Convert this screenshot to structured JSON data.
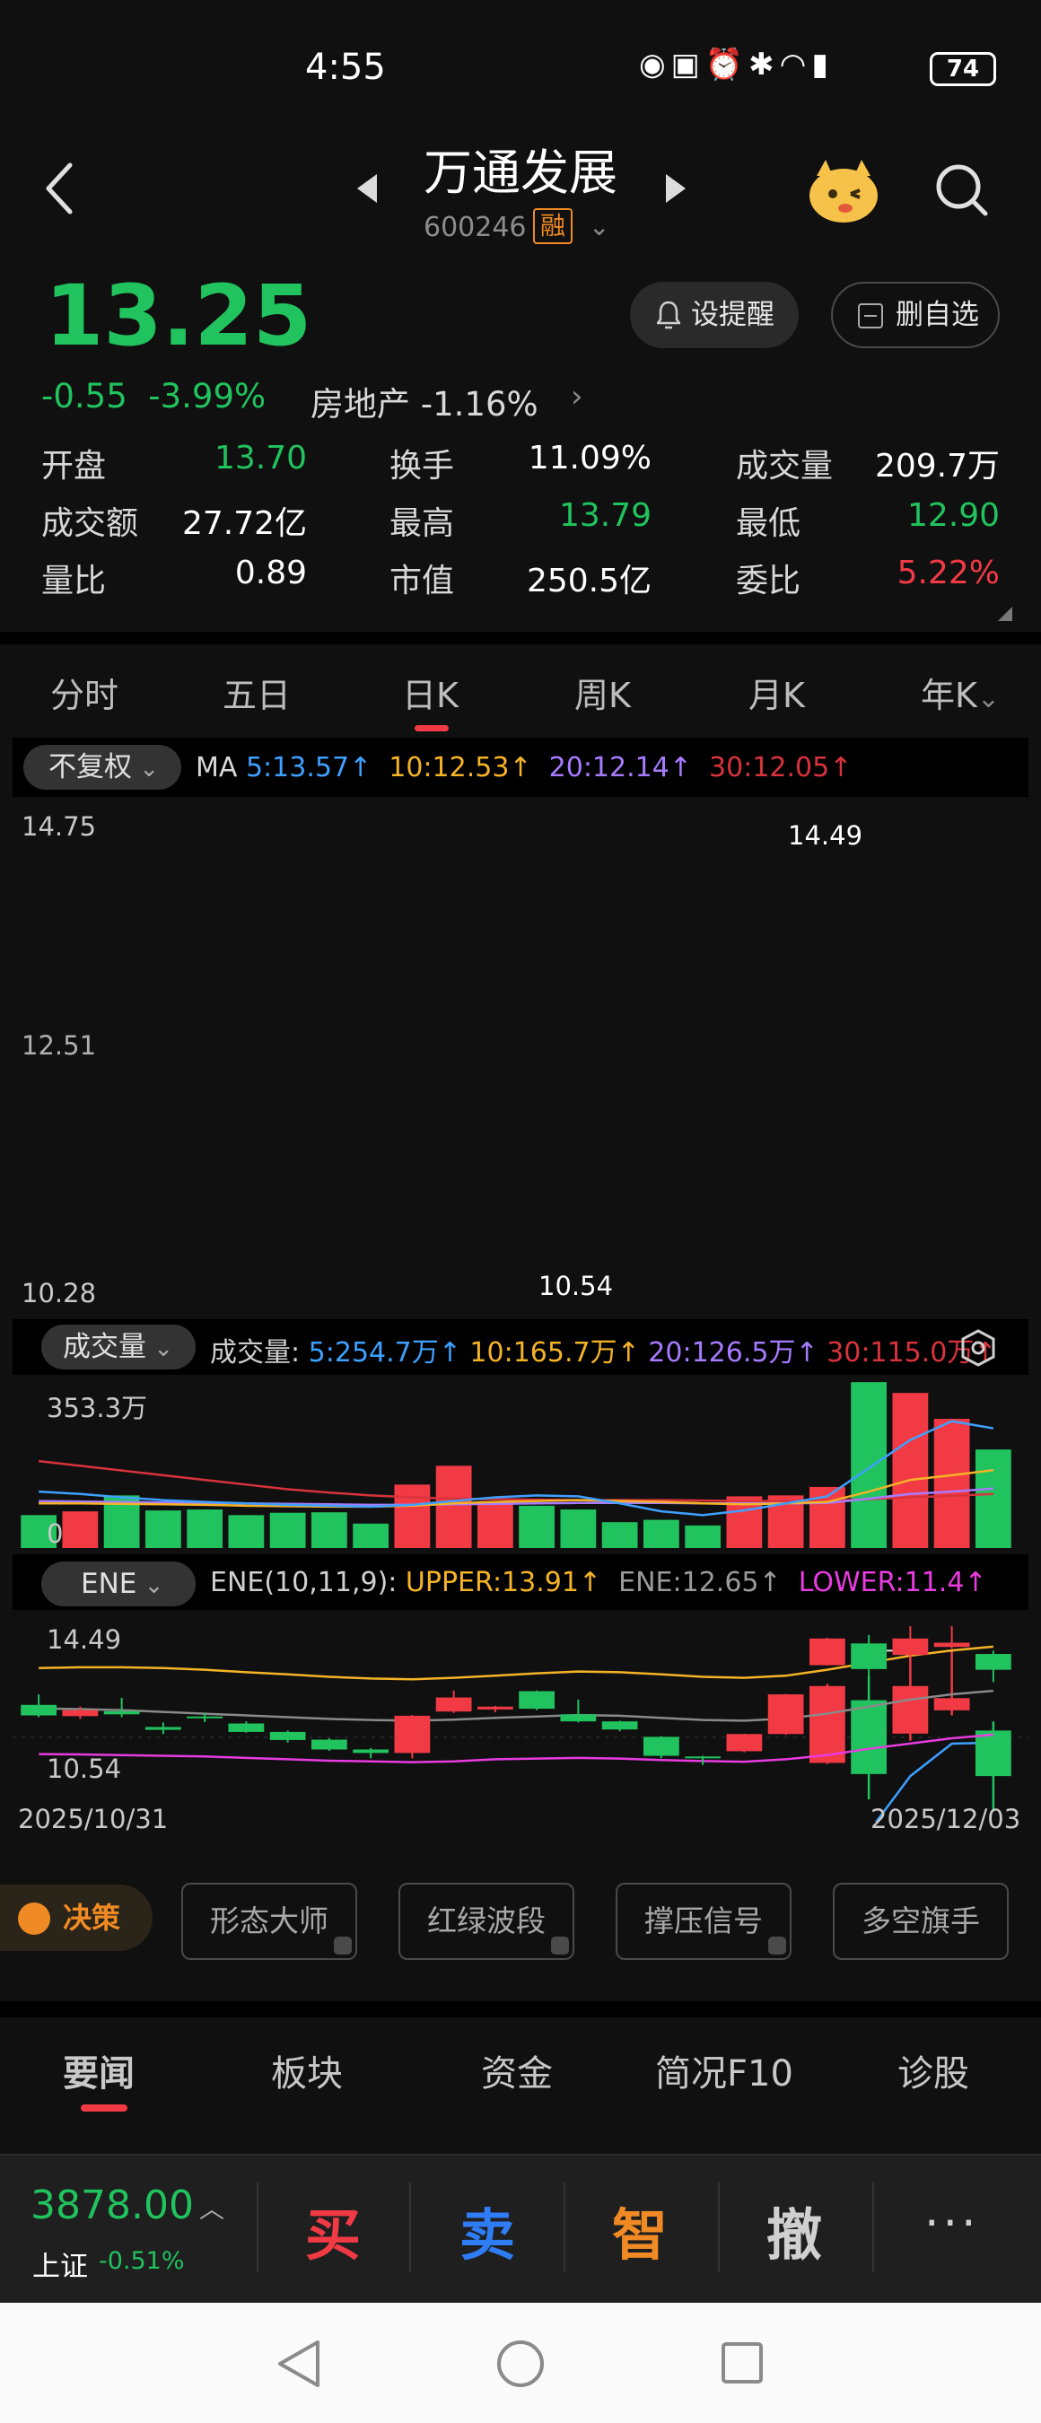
{
  "status": {
    "time": "4:55",
    "battery": "74"
  },
  "header": {
    "stock_name": "万通发展",
    "stock_code": "600246",
    "margin_badge": "融"
  },
  "quote": {
    "price": "13.25",
    "change": "-0.55",
    "change_pct": "-3.99%",
    "sector": "房地产",
    "sector_pct": "-1.16%",
    "remind_label": "设提醒",
    "watch_label": "删自选",
    "open_label": "开盘",
    "open": "13.70",
    "turnover_label": "换手",
    "turnover": "11.09%",
    "volume_label": "成交量",
    "volume": "209.7万",
    "amount_label": "成交额",
    "amount": "27.72亿",
    "high_label": "最高",
    "high": "13.79",
    "low_label": "最低",
    "low": "12.90",
    "vol_ratio_label": "量比",
    "vol_ratio": "0.89",
    "mktcap_label": "市值",
    "mktcap": "250.5亿",
    "commit_label": "委比",
    "commit": "5.22%"
  },
  "kline_tabs": [
    "分时",
    "五日",
    "日K",
    "周K",
    "月K",
    "年K"
  ],
  "ma_bar": {
    "adjust_label": "不复权",
    "ma_label": "MA",
    "ma5": "5:13.57↑",
    "ma10": "10:12.53↑",
    "ma20": "20:12.14↑",
    "ma30": "30:12.05↑"
  },
  "volume_bar": {
    "select_label": "成交量",
    "prefix": "成交量:",
    "v5": "5:254.7万↑",
    "v10": "10:165.7万↑",
    "v20": "20:126.5万↑",
    "v30": "30:115.0万↑",
    "max_label": "353.3万",
    "zero_label": "0"
  },
  "ene_bar": {
    "select_label": "ENE",
    "prefix": "ENE(10,11,9):",
    "upper": "UPPER:13.91↑",
    "ene": "ENE:12.65↑",
    "lower": "LOWER:11.4↑",
    "top_label": "14.49",
    "bottom_label": "10.54"
  },
  "price_axis": {
    "top": "14.75",
    "bottom": "10.28",
    "dashed": "12.51",
    "high_mark": "14.49",
    "low_mark": "10.54"
  },
  "dates": {
    "start": "2025/10/31",
    "end": "2025/12/03"
  },
  "colors": {
    "up": "#f23a45",
    "down": "#21c35e",
    "ma5": "#3ea0ff",
    "ma10": "#f5b326",
    "ma20": "#a77bff",
    "ma30": "#d8333c"
  },
  "tools": {
    "decision_label": "决策",
    "buttons": [
      "形态大师",
      "红绿波段",
      "撑压信号",
      "多空旗手"
    ]
  },
  "news_tabs": [
    "要闻",
    "板块",
    "资金",
    "简况F10",
    "诊股"
  ],
  "trade_bar": {
    "index_value": "3878.00",
    "index_name": "上证",
    "index_pct": "-0.51%",
    "buy": "买",
    "sell": "卖",
    "smart": "智",
    "cancel": "撤",
    "more": "···"
  },
  "chart_data": {
    "type": "candlestick",
    "x_start": "2025/10/31",
    "x_end": "2025/12/03",
    "ylim": [
      10.28,
      14.75
    ],
    "candles": [
      {
        "o": 12.25,
        "c": 11.95,
        "h": 12.55,
        "l": 11.9
      },
      {
        "o": 11.93,
        "c": 12.1,
        "h": 12.2,
        "l": 11.85
      },
      {
        "o": 12.07,
        "c": 11.98,
        "h": 12.45,
        "l": 11.9
      },
      {
        "o": 11.62,
        "c": 11.54,
        "h": 11.75,
        "l": 11.42
      },
      {
        "o": 11.92,
        "c": 11.88,
        "h": 12.02,
        "l": 11.76
      },
      {
        "o": 11.72,
        "c": 11.48,
        "h": 11.78,
        "l": 11.46
      },
      {
        "o": 11.48,
        "c": 11.25,
        "h": 11.52,
        "l": 11.18
      },
      {
        "o": 11.26,
        "c": 10.98,
        "h": 11.3,
        "l": 10.94
      },
      {
        "o": 10.98,
        "c": 10.88,
        "h": 11.02,
        "l": 10.73
      },
      {
        "o": 10.88,
        "c": 11.94,
        "h": 11.96,
        "l": 10.73
      },
      {
        "o": 12.06,
        "c": 12.46,
        "h": 12.66,
        "l": 12.02
      },
      {
        "o": 12.12,
        "c": 12.2,
        "h": 12.22,
        "l": 12.04
      },
      {
        "o": 12.64,
        "c": 12.14,
        "h": 12.66,
        "l": 12.1
      },
      {
        "o": 11.98,
        "c": 11.78,
        "h": 12.4,
        "l": 11.75
      },
      {
        "o": 11.78,
        "c": 11.55,
        "h": 11.8,
        "l": 11.5
      },
      {
        "o": 11.34,
        "c": 10.8,
        "h": 11.36,
        "l": 10.73
      },
      {
        "o": 10.78,
        "c": 10.76,
        "h": 10.8,
        "l": 10.54
      },
      {
        "o": 10.93,
        "c": 11.42,
        "h": 11.43,
        "l": 10.9
      },
      {
        "o": 11.42,
        "c": 12.55,
        "h": 12.56,
        "l": 11.4
      },
      {
        "o": 13.38,
        "c": 14.14,
        "h": 14.16,
        "l": 13.37
      },
      {
        "o": 14.0,
        "c": 13.27,
        "h": 14.24,
        "l": 13.02
      },
      {
        "o": 13.67,
        "c": 14.14,
        "h": 14.49,
        "l": 13.6
      },
      {
        "o": 13.9,
        "c": 14.02,
        "h": 14.49,
        "l": 13.85
      },
      {
        "o": 13.7,
        "c": 13.25,
        "h": 13.79,
        "l": 12.9
      }
    ],
    "ma5": [
      12.05,
      12.05,
      12.02,
      11.94,
      11.9,
      11.76,
      11.63,
      11.43,
      11.3,
      11.3,
      11.5,
      11.8,
      12.0,
      12.2,
      12.1,
      11.9,
      11.6,
      11.4,
      11.55,
      12.15,
      12.7,
      13.25,
      13.57,
      13.58
    ],
    "ma10": [
      11.95,
      11.98,
      12.0,
      11.98,
      11.95,
      11.85,
      11.75,
      11.65,
      11.6,
      11.58,
      11.6,
      11.68,
      11.72,
      11.8,
      11.78,
      11.75,
      11.65,
      11.62,
      11.7,
      11.9,
      12.1,
      12.3,
      12.45,
      12.53
    ],
    "ma20": [
      11.98,
      11.98,
      11.97,
      11.95,
      11.92,
      11.88,
      11.82,
      11.78,
      11.74,
      11.72,
      11.74,
      11.78,
      11.8,
      11.82,
      11.8,
      11.78,
      11.74,
      11.72,
      11.76,
      11.85,
      11.92,
      12.0,
      12.08,
      12.14
    ],
    "ma30": [
      12.5,
      12.4,
      12.3,
      12.2,
      12.1,
      12.0,
      11.95,
      11.9,
      11.85,
      11.82,
      11.82,
      11.85,
      11.85,
      11.86,
      11.85,
      11.83,
      11.8,
      11.78,
      11.8,
      11.85,
      11.9,
      11.95,
      12.0,
      12.05
    ],
    "volume": {
      "ylim": [
        0,
        353.3
      ],
      "values": [
        70,
        78,
        112,
        80,
        82,
        70,
        75,
        76,
        52,
        135,
        175,
        100,
        90,
        82,
        55,
        60,
        48,
        110,
        112,
        130,
        353,
        330,
        275,
        209.7
      ],
      "ma5": [
        120,
        115,
        108,
        102,
        98,
        95,
        92,
        90,
        88,
        92,
        100,
        108,
        112,
        110,
        95,
        78,
        70,
        80,
        95,
        110,
        170,
        230,
        270,
        254.7
      ],
      "ma10": [
        95,
        95,
        94,
        93,
        92,
        90,
        89,
        88,
        88,
        90,
        95,
        98,
        100,
        102,
        100,
        98,
        95,
        93,
        95,
        98,
        120,
        145,
        155,
        165.7
      ],
      "ma20": [
        100,
        99,
        98,
        97,
        96,
        95,
        94,
        93,
        92,
        92,
        93,
        94,
        95,
        96,
        96,
        96,
        95,
        95,
        95,
        96,
        105,
        115,
        120,
        126.5
      ],
      "ma30": [
        185,
        175,
        165,
        155,
        145,
        135,
        125,
        118,
        112,
        108,
        105,
        104,
        103,
        102,
        102,
        102,
        101,
        100,
        100,
        100,
        104,
        108,
        111,
        115.0
      ]
    },
    "ene": {
      "ylim": [
        10.2,
        14.8
      ],
      "upper": [
        13.3,
        13.32,
        13.32,
        13.3,
        13.25,
        13.18,
        13.12,
        13.05,
        13.0,
        12.98,
        13.02,
        13.08,
        13.15,
        13.2,
        13.18,
        13.12,
        13.05,
        13.02,
        13.08,
        13.25,
        13.45,
        13.65,
        13.8,
        13.91
      ],
      "mid": [
        12.15,
        12.13,
        12.1,
        12.05,
        12.0,
        11.95,
        11.9,
        11.85,
        11.82,
        11.8,
        11.83,
        11.88,
        11.92,
        11.96,
        11.94,
        11.88,
        11.82,
        11.8,
        11.86,
        12.0,
        12.2,
        12.4,
        12.55,
        12.65
      ],
      "lower": [
        10.85,
        10.84,
        10.82,
        10.8,
        10.78,
        10.74,
        10.7,
        10.66,
        10.64,
        10.62,
        10.64,
        10.7,
        10.72,
        10.74,
        10.72,
        10.68,
        10.65,
        10.63,
        10.7,
        10.82,
        11.0,
        11.15,
        11.3,
        11.4
      ]
    }
  }
}
